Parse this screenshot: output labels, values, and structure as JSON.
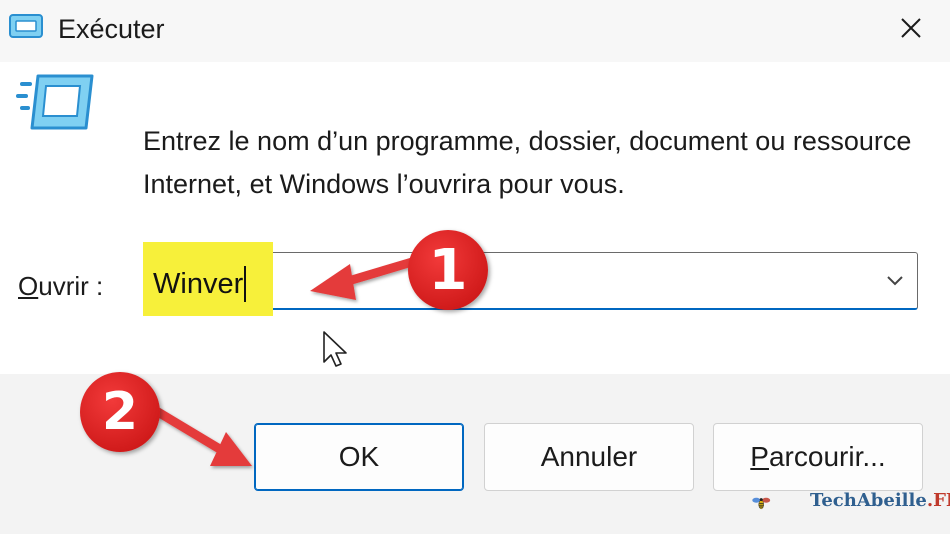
{
  "window": {
    "title": "Exécuter",
    "close_icon": "close-icon"
  },
  "content": {
    "description": "Entrez le nom d’un programme, dossier, document ou ressource Internet, et Windows l’ouvrira pour vous.",
    "open_label_underlined": "O",
    "open_label_rest": "uvrir :",
    "input_value": "Winver"
  },
  "buttons": {
    "ok": "OK",
    "cancel": "Annuler",
    "browse_underlined": "P",
    "browse_rest": "arcourir..."
  },
  "annotations": {
    "step1": "1",
    "step2": "2"
  },
  "watermark": {
    "name": "TechAbeille",
    "suffix": ".FR"
  },
  "colors": {
    "accent": "#0067c0",
    "highlight": "#f7f03a",
    "badge": "#d91c1c",
    "arrow": "#e43b3b"
  }
}
